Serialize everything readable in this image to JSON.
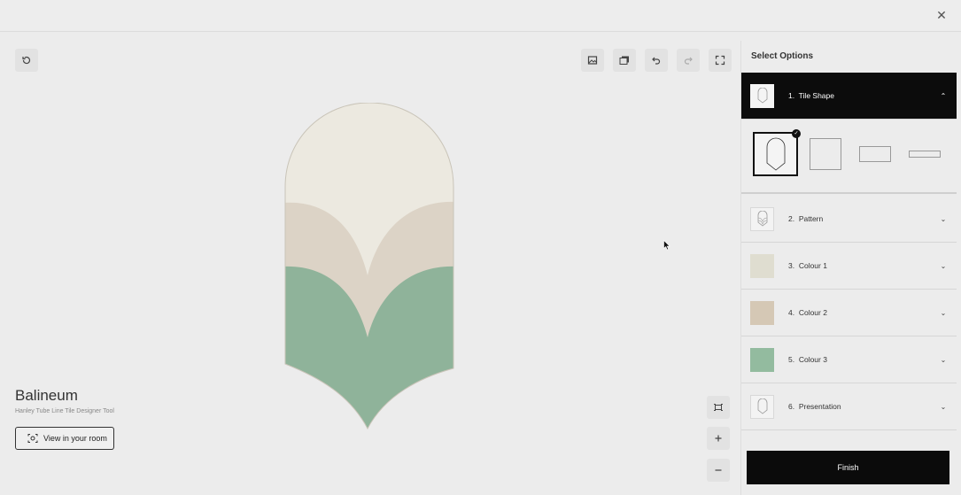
{
  "window": {
    "close_icon": "close-icon"
  },
  "toolbar": {
    "reset": "reset-icon",
    "image": "image-icon",
    "gallery": "gallery-icon",
    "undo": "undo-icon",
    "redo": "redo-icon",
    "fullscreen": "fullscreen-icon"
  },
  "product": {
    "title": "Balineum",
    "subtitle": "Hanley Tube Line Tile Designer Tool",
    "room_button": "View in your room"
  },
  "colors": {
    "colour1": "#ece9e0",
    "colour2": "#dcd3c6",
    "colour3": "#8fb39a",
    "accent": "#0b0b0b"
  },
  "panel": {
    "title": "Select Options",
    "options": [
      {
        "num": "1.",
        "label": "Tile Shape",
        "expanded": true
      },
      {
        "num": "2.",
        "label": "Pattern"
      },
      {
        "num": "3.",
        "label": "Colour 1"
      },
      {
        "num": "4.",
        "label": "Colour 2"
      },
      {
        "num": "5.",
        "label": "Colour 3"
      },
      {
        "num": "6.",
        "label": "Presentation"
      }
    ],
    "shapes": [
      "arch-shape",
      "square-shape",
      "rectangle-shape",
      "long-rectangle-shape"
    ],
    "finish": "Finish"
  }
}
